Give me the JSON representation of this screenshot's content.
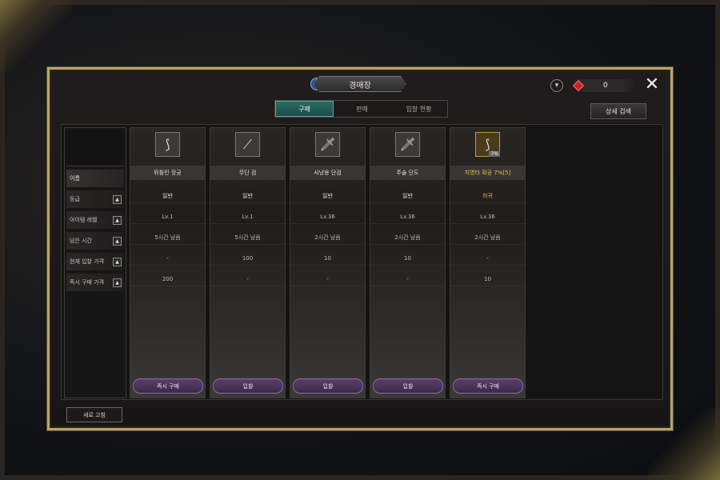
{
  "title": "경매장",
  "currency": {
    "value": "0"
  },
  "tabs": [
    {
      "label": "구매",
      "active": true
    },
    {
      "label": "판매",
      "active": false
    },
    {
      "label": "입찰 현황",
      "active": false
    }
  ],
  "detail_search_label": "상세 검색",
  "labels": [
    "이름",
    "등급",
    "아이템 레벨",
    "남은 시간",
    "현재 입찰 가격",
    "즉시 구매 가격"
  ],
  "items": [
    {
      "name": "뒤틀린 장궁",
      "grade": "일반",
      "level": "Lv.1",
      "remaining": "5시간 남음",
      "current_bid": "-",
      "buyout": "200",
      "action": "즉시 구매",
      "icon": "bow-icon",
      "rare": false
    },
    {
      "name": "무딘 검",
      "grade": "일반",
      "level": "Lv.1",
      "remaining": "5시간 남음",
      "current_bid": "100",
      "buyout": "-",
      "action": "입찰",
      "icon": "sword-icon",
      "rare": false
    },
    {
      "name": "사냥용 단검",
      "grade": "일반",
      "level": "Lv.36",
      "remaining": "2시간 남음",
      "current_bid": "10",
      "buyout": "-",
      "action": "입찰",
      "icon": "dagger-icon",
      "rare": false
    },
    {
      "name": "주술 단도",
      "grade": "일반",
      "level": "Lv.36",
      "remaining": "2시간 남음",
      "current_bid": "10",
      "buyout": "-",
      "action": "입찰",
      "icon": "dagger-icon",
      "rare": false
    },
    {
      "name": "치명타 확공 7%[5]",
      "grade": "희귀",
      "level": "Lv.36",
      "remaining": "2시간 남음",
      "current_bid": "-",
      "buyout": "10",
      "action": "즉시 구매",
      "icon": "bow-icon",
      "rare": true,
      "badge": "7%"
    }
  ],
  "refresh_label": "새로 고침",
  "colors": {
    "frame_gold": "#b7a46b",
    "tab_active": "#2a6a64",
    "action_purple": "#5a3f6a",
    "rare_gold": "#e1b13f"
  }
}
